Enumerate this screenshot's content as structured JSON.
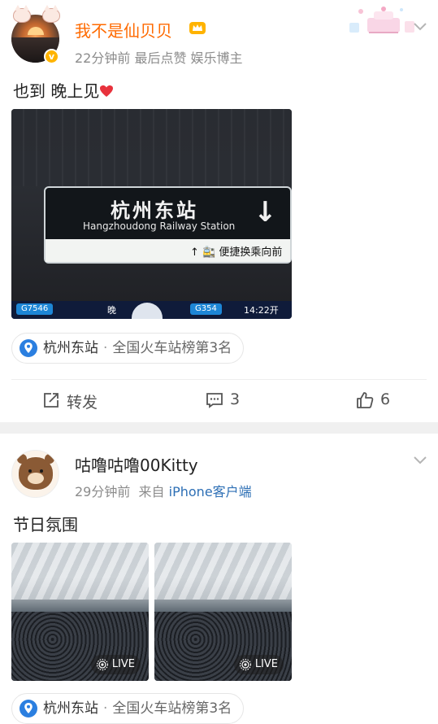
{
  "post1": {
    "username": "我不是仙贝贝",
    "meta": "22分钟前 最后点赞   娱乐博主",
    "text": "也到 晚上见",
    "photo": {
      "sign_cn": "杭州东站",
      "sign_en": "Hangzhoudong Railway Station",
      "sign_sub": "↑ 🚉 便捷换乘向前",
      "board_train1": "G7546",
      "board_mid": "晚",
      "board_train2": "G354",
      "board_time": "14:22开"
    },
    "location": {
      "name": "杭州东站",
      "rank": "全国火车站榜第3名"
    },
    "actions": {
      "repost_label": "转发",
      "comment_count": "3",
      "like_count": "6"
    }
  },
  "post2": {
    "username": "咕噜咕噜00Kitty",
    "time": "29分钟前",
    "from_prefix": "来自",
    "source": "iPhone客户端",
    "text": "节日氛围",
    "live_label": "LIVE",
    "location": {
      "name": "杭州东站",
      "rank": "全国火车站榜第3名"
    }
  },
  "colors": {
    "vip_name": "#ff6a00",
    "link": "#2d6fb5",
    "meta": "#8c8c8c",
    "pin": "#2b7fe0"
  }
}
